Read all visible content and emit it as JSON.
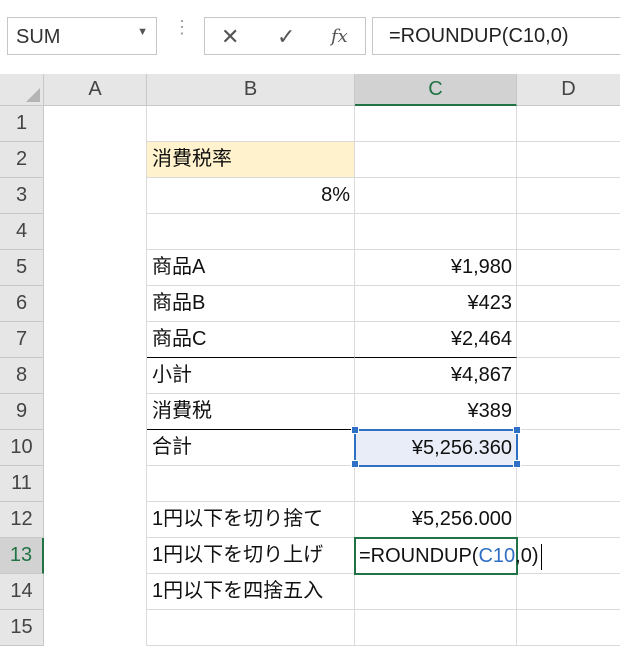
{
  "formula_bar": {
    "name_box": "SUM",
    "cancel_icon": "✕",
    "enter_icon": "✓",
    "fx_label": "fx",
    "formula": "=ROUNDUP(C10,0)"
  },
  "columns": [
    "A",
    "B",
    "C",
    "D"
  ],
  "rows": [
    "1",
    "2",
    "3",
    "4",
    "5",
    "6",
    "7",
    "8",
    "9",
    "10",
    "11",
    "12",
    "13",
    "14",
    "15"
  ],
  "cells": {
    "b2": "消費税率",
    "b3": "8%",
    "b5": "商品A",
    "c5": "¥1,980",
    "b6": "商品B",
    "c6": "¥423",
    "b7": "商品C",
    "c7": "¥2,464",
    "b8": "小計",
    "c8": "¥4,867",
    "b9": "消費税",
    "c9": "¥389",
    "b10": "合計",
    "c10": "¥5,256.360",
    "b12": "1円以下を切り捨て",
    "c12": "¥5,256.000",
    "b13": "1円以下を切り上げ",
    "c13_prefix": "=ROUNDUP(",
    "c13_ref": "C10",
    "c13_suffix": ",0)",
    "b14": "1円以下を四捨五入"
  },
  "colors": {
    "accent_green": "#217346",
    "selection_blue": "#2f6fc4",
    "highlight_yellow": "#fff2cc"
  }
}
